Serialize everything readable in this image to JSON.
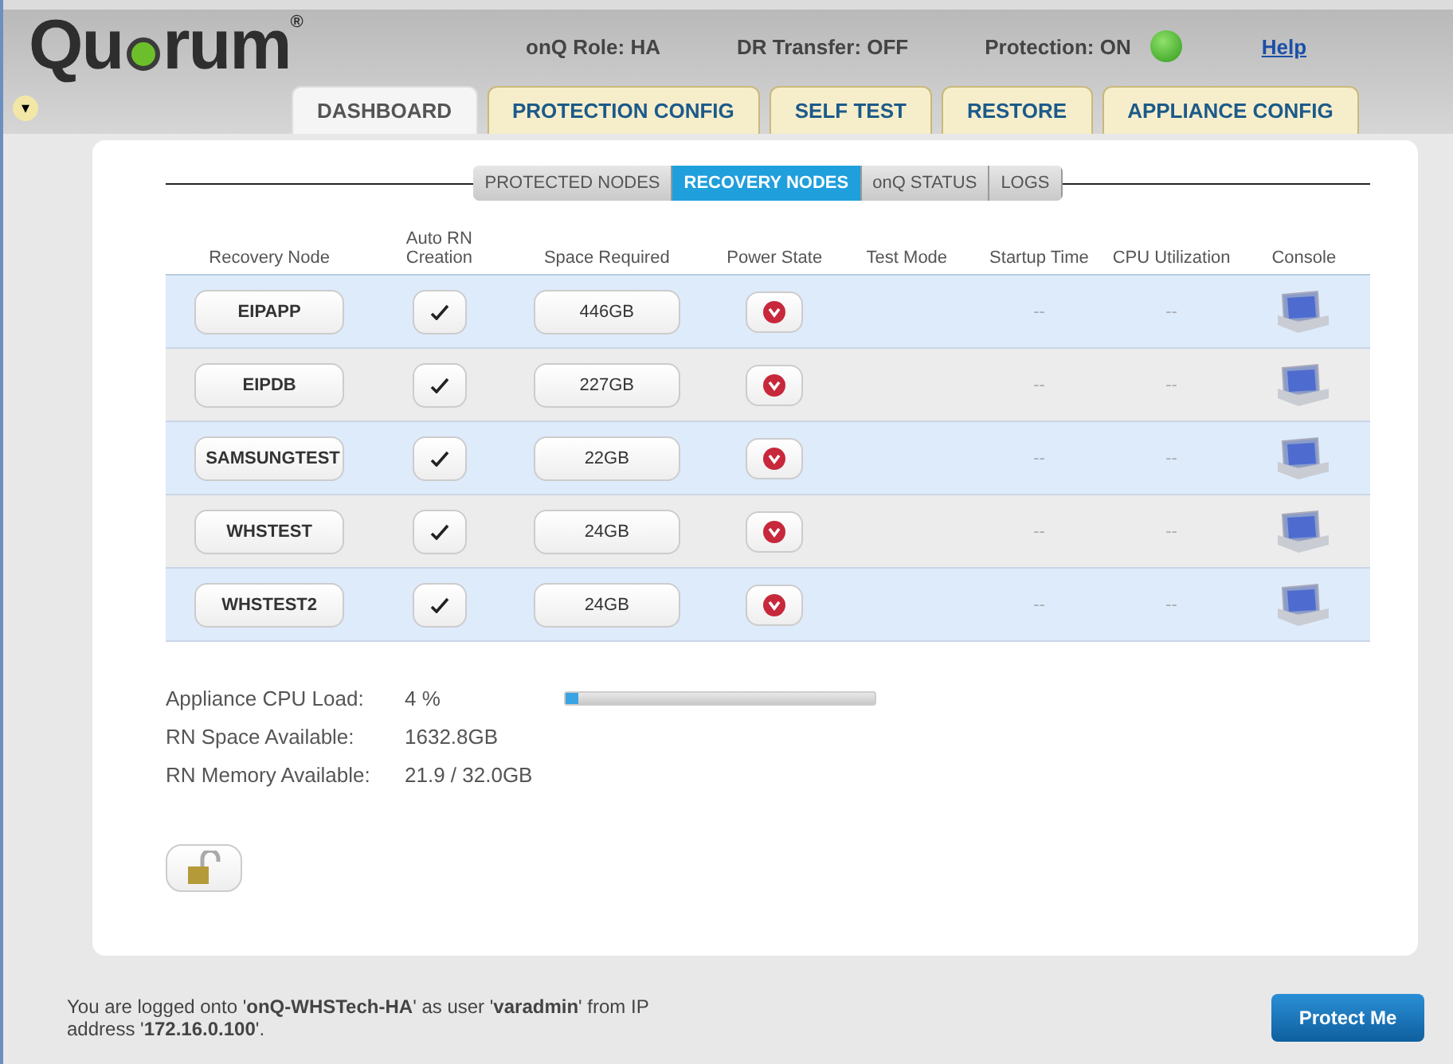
{
  "logo": {
    "before": "Qu",
    "after": "rum",
    "mark": "®"
  },
  "status": {
    "role": "onQ Role: HA",
    "dr_transfer": "DR Transfer: OFF",
    "protection": "Protection: ON",
    "protection_on": true,
    "help": "Help"
  },
  "menu_toggle": "▾",
  "tabs": [
    {
      "label": "DASHBOARD",
      "selected": true
    },
    {
      "label": "PROTECTION CONFIG",
      "selected": false
    },
    {
      "label": "SELF TEST",
      "selected": false
    },
    {
      "label": "RESTORE",
      "selected": false
    },
    {
      "label": "APPLIANCE CONFIG",
      "selected": false
    }
  ],
  "subtabs": [
    {
      "label": "PROTECTED NODES",
      "selected": false
    },
    {
      "label": "RECOVERY NODES",
      "selected": true
    },
    {
      "label": "onQ STATUS",
      "selected": false
    },
    {
      "label": "LOGS",
      "selected": false
    }
  ],
  "table": {
    "columns": [
      "Recovery Node",
      "Auto RN Creation",
      "Space Required",
      "Power State",
      "Test Mode",
      "Startup Time",
      "CPU Utilization",
      "Console"
    ],
    "rows": [
      {
        "node": "EIPAPP",
        "auto": true,
        "space": "446GB",
        "power_on": false,
        "startup": "--",
        "cpu": "--"
      },
      {
        "node": "EIPDB",
        "auto": true,
        "space": "227GB",
        "power_on": false,
        "startup": "--",
        "cpu": "--"
      },
      {
        "node": "SAMSUNGTEST",
        "auto": true,
        "space": "22GB",
        "power_on": false,
        "startup": "--",
        "cpu": "--"
      },
      {
        "node": "WHSTEST",
        "auto": true,
        "space": "24GB",
        "power_on": false,
        "startup": "--",
        "cpu": "--"
      },
      {
        "node": "WHSTEST2",
        "auto": true,
        "space": "24GB",
        "power_on": false,
        "startup": "--",
        "cpu": "--"
      }
    ]
  },
  "stats": {
    "cpu_label": "Appliance CPU Load:",
    "cpu_value": "4 %",
    "level": 0.04,
    "space_label": "RN Space Available:",
    "space_value": "1632.8GB",
    "memory_label": "RN Memory Available:",
    "memory_value": "21.9 / 32.0GB"
  },
  "footer": {
    "message": "You are logged onto '**onQ-WHSTech-HA**' as user '**varadmin**' from IP address '**172.16.0.100**'.",
    "button": "Protect Me"
  }
}
